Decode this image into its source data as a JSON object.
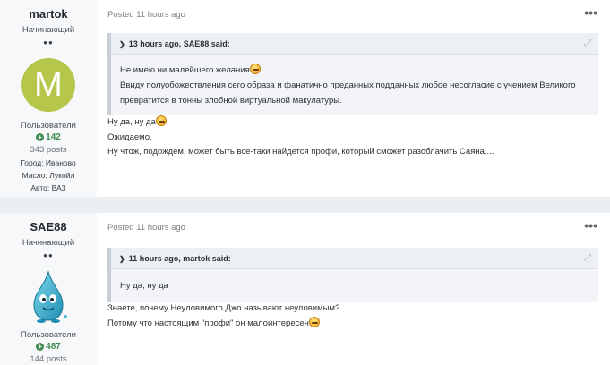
{
  "posts": [
    {
      "author": "martok",
      "rank": "Начинающий",
      "pips": "●●",
      "avatar_letter": "M",
      "group": "Пользователи",
      "reputation": "142",
      "post_count": "343 posts",
      "fields": [
        "Город: Иваново",
        "Масло: Лукойл",
        "Авто: ВАЗ"
      ],
      "meta": "Posted 11 hours ago",
      "menu": "•••",
      "quote": {
        "header": "13 hours ago, SAE88 said:",
        "lines": [
          "Не имею ни малейшего желания",
          "Ввиду полуобожествления сего образа и фанатично преданных подданных любое несогласие с учением Великого превратится в тонны злобной виртуальной макулатуры."
        ]
      },
      "body": [
        "Ну да, ну да",
        "Ожидаемо.",
        "Ну чтож, подождем, может быть все-таки найдется профи, который сможет разоблачить Саяна...."
      ]
    },
    {
      "author": "SAE88",
      "rank": "Начинающий",
      "pips": "●●",
      "group": "Пользователи",
      "reputation": "487",
      "post_count": "144 posts",
      "meta": "Posted 11 hours ago",
      "menu": "•••",
      "quote": {
        "header": "11 hours ago, martok said:",
        "lines": [
          "Ну да, ну да"
        ]
      },
      "body": [
        "Знаете, почему Неуловимого Джо называют неуловимым?",
        "Потому что настоящим \"профи\" он малоинтересен"
      ]
    }
  ],
  "colors": {
    "avatar_bg": "#b6c64a",
    "reputation": "#3d8b4f",
    "quote_bar": "#c9cfd6"
  },
  "icons": {
    "quote_chevron": "chevron-right-icon",
    "quote_expand": "expand-icon",
    "emoji": "smile-emoji-icon"
  }
}
